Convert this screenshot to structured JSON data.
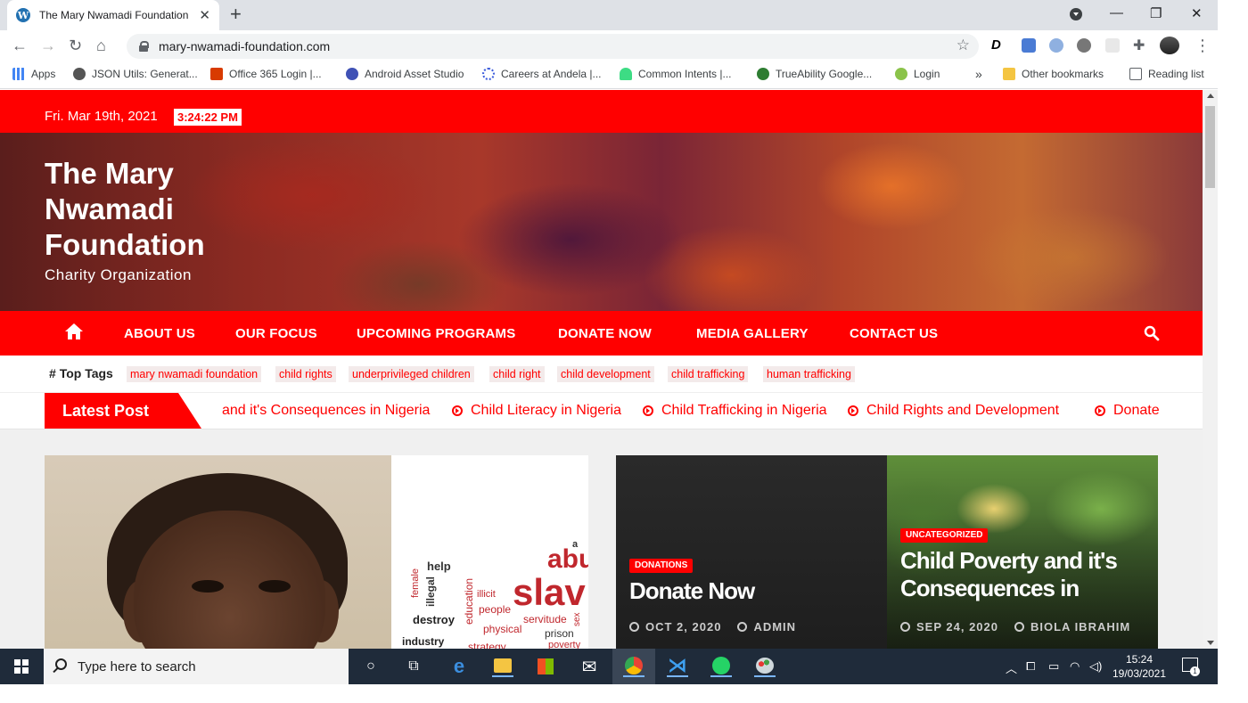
{
  "browser": {
    "tab_title": "The Mary Nwamadi Foundation",
    "url": "mary-nwamadi-foundation.com",
    "bookmarks": [
      {
        "label": "Apps",
        "color": "#4285f4"
      },
      {
        "label": "JSON Utils: Generat...",
        "color": "#555555"
      },
      {
        "label": "Office 365 Login |...",
        "color": "#d83b01"
      },
      {
        "label": "Android Asset Studio",
        "color": "#3f51b5"
      },
      {
        "label": "Careers at Andela |...",
        "color": "#3b5bdb"
      },
      {
        "label": "Common Intents |...",
        "color": "#3ddc84"
      },
      {
        "label": "TrueAbility Google...",
        "color": "#2e7d32"
      },
      {
        "label": "Login",
        "color": "#8bc34a"
      }
    ],
    "overflow_label": "»",
    "other_bookmarks": "Other bookmarks",
    "reading_list": "Reading list"
  },
  "site": {
    "date": "Fri. Mar 19th, 2021",
    "time": "3:24:22 PM",
    "title": "The Mary Nwamadi Foundation",
    "tagline": "Charity Organization",
    "nav": [
      "ABOUT US",
      "OUR FOCUS",
      "UPCOMING PROGRAMS",
      "DONATE NOW",
      "MEDIA GALLERY",
      "CONTACT US"
    ],
    "top_tags_label": "Top Tags",
    "tags": [
      "mary nwamadi foundation",
      "child rights",
      "underprivileged children",
      "child right",
      "child development",
      "child trafficking",
      "human trafficking"
    ],
    "latest_label": "Latest Post",
    "ticker": [
      "and it's Consequences in Nigeria",
      "Child Literacy in Nigeria",
      "Child Trafficking in Nigeria",
      "Child Rights and Development",
      "Donate"
    ],
    "wordcloud": [
      "abu",
      "slav",
      "help",
      "female",
      "illegal",
      "destroy",
      "education",
      "illicit",
      "people",
      "physical",
      "servitude",
      "prison",
      "industry",
      "strategy",
      "poverty",
      "sex",
      "a"
    ],
    "posts": [
      {
        "category": "DONATIONS",
        "title": "Donate Now",
        "date": "OCT 2, 2020",
        "author": "ADMIN"
      },
      {
        "category": "UNCATEGORIZED",
        "title_line1": "Child Poverty and it's",
        "title_line2": "Consequences in",
        "date": "SEP 24, 2020",
        "author": "BIOLA IBRAHIM"
      }
    ]
  },
  "taskbar": {
    "search_placeholder": "Type here to search",
    "time": "15:24",
    "date": "19/03/2021",
    "notification_count": "1"
  },
  "colors": {
    "brand_red": "#ff0000",
    "taskbar": "#1f2b3a"
  }
}
